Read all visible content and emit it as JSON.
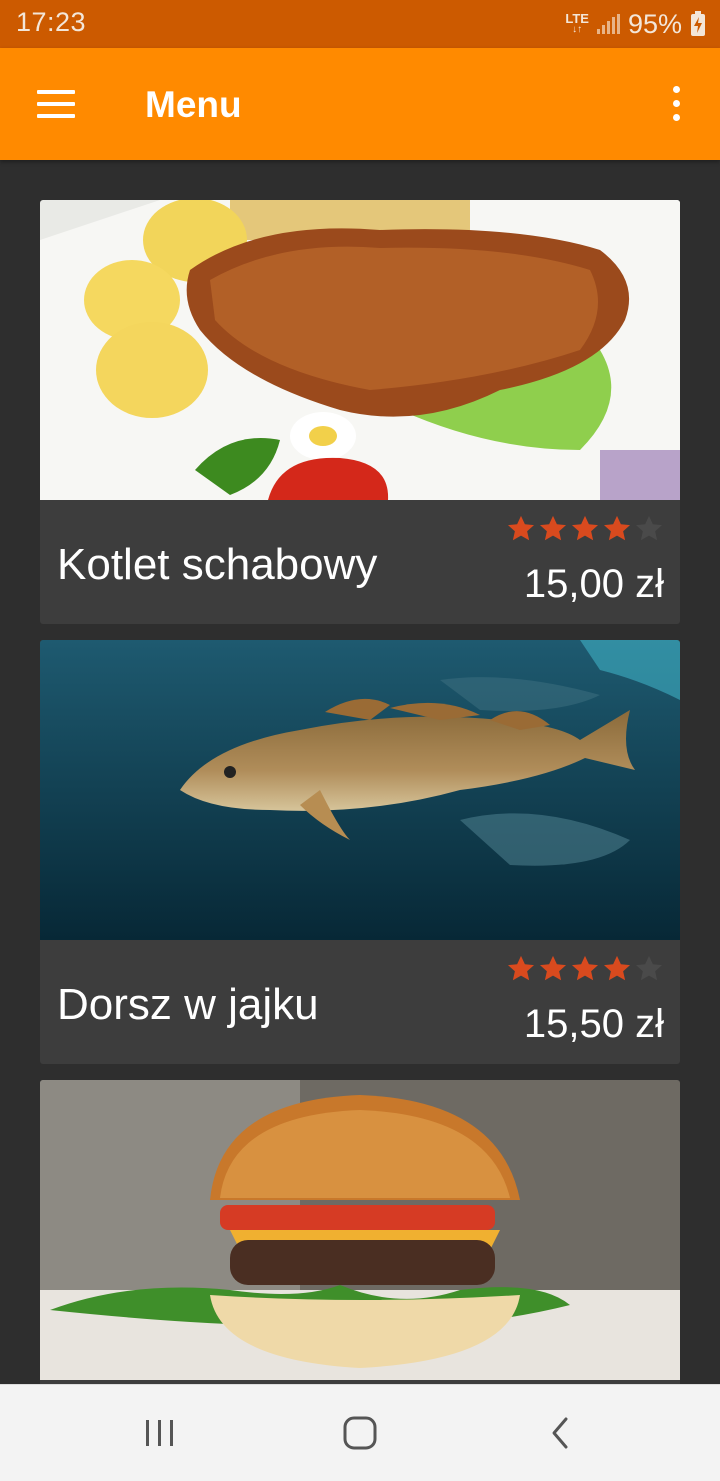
{
  "status_bar": {
    "time": "17:23",
    "network": "LTE",
    "battery": "95%"
  },
  "app_bar": {
    "title": "Menu",
    "color": "#ff8a00",
    "menu_icon": "hamburger-menu-icon",
    "more_icon": "more-vertical-icon"
  },
  "menu_items": [
    {
      "name": "Kotlet schabowy",
      "price": "15,00 zł",
      "rating": 4,
      "rating_max": 5,
      "image": "pork-cutlet-photo"
    },
    {
      "name": "Dorsz w jajku",
      "price": "15,50 zł",
      "rating": 4,
      "rating_max": 5,
      "image": "cod-fish-photo"
    },
    {
      "name": "",
      "price": "",
      "rating": null,
      "rating_max": 5,
      "image": "burger-photo"
    }
  ],
  "colors": {
    "star_filled": "#d94a1e",
    "star_empty": "#4a4a4a",
    "card_background": "#3d3d3d",
    "page_background": "#2e2e2e"
  },
  "nav_bar": {
    "recents_icon": "recents-icon",
    "home_icon": "home-icon",
    "back_icon": "back-icon"
  }
}
